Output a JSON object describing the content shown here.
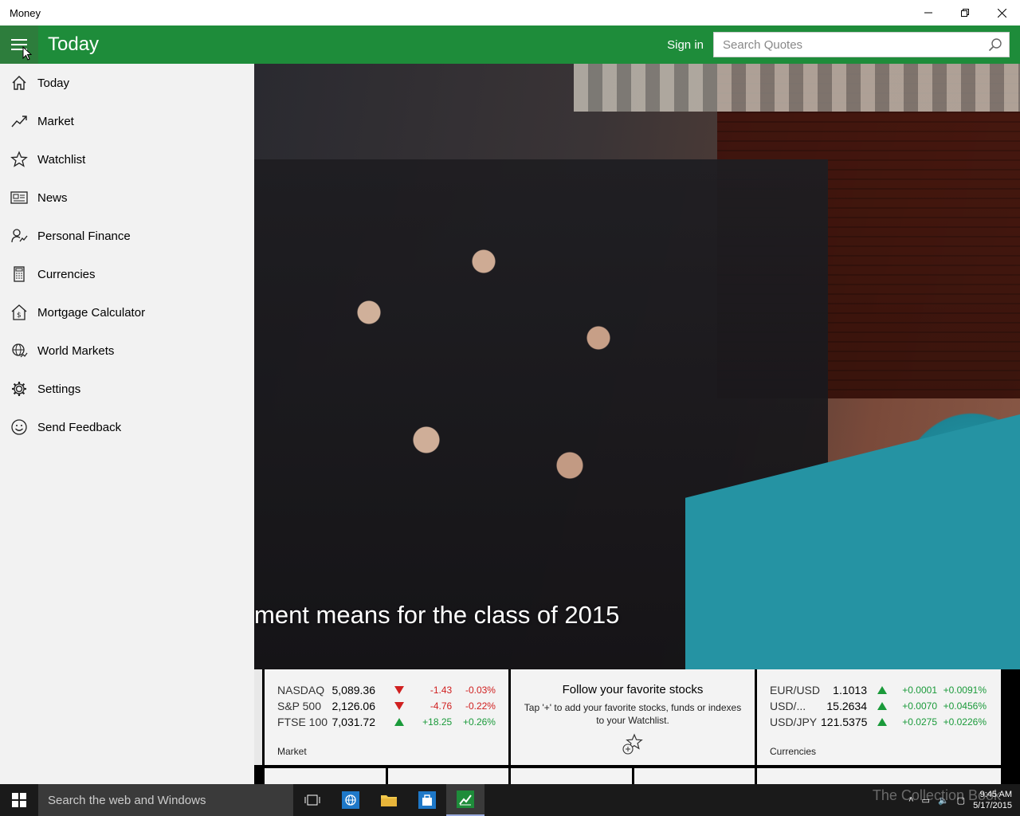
{
  "window": {
    "title": "Money",
    "minimize": "—",
    "maximize": "❐",
    "close": "✕"
  },
  "header": {
    "page_title": "Today",
    "sign_in": "Sign in",
    "search_placeholder": "Search Quotes",
    "accent": "#1e8c3a"
  },
  "sidebar": {
    "items": [
      {
        "label": "Today",
        "icon": "home-icon"
      },
      {
        "label": "Market",
        "icon": "trend-icon"
      },
      {
        "label": "Watchlist",
        "icon": "star-icon"
      },
      {
        "label": "News",
        "icon": "news-icon"
      },
      {
        "label": "Personal Finance",
        "icon": "personal-finance-icon"
      },
      {
        "label": "Currencies",
        "icon": "calculator-icon"
      },
      {
        "label": "Mortgage Calculator",
        "icon": "house-dollar-icon"
      },
      {
        "label": "World Markets",
        "icon": "globe-icon"
      },
      {
        "label": "Settings",
        "icon": "gear-icon"
      },
      {
        "label": "Send Feedback",
        "icon": "smiley-icon"
      }
    ]
  },
  "hero": {
    "headline": "ment means for the class of 2015"
  },
  "market_tile": {
    "label": "Market",
    "rows": [
      {
        "name": "NASDAQ",
        "value": "5,089.36",
        "dir": "down",
        "change": "-1.43",
        "pct": "-0.03%"
      },
      {
        "name": "S&P 500",
        "value": "2,126.06",
        "dir": "down",
        "change": "-4.76",
        "pct": "-0.22%"
      },
      {
        "name": "FTSE 100",
        "value": "7,031.72",
        "dir": "up",
        "change": "+18.25",
        "pct": "+0.26%"
      }
    ]
  },
  "watchlist_tile": {
    "title": "Follow your favorite stocks",
    "desc": "Tap '+' to add your favorite stocks, funds or indexes to your Watchlist."
  },
  "currencies_tile": {
    "label": "Currencies",
    "rows": [
      {
        "name": "EUR/USD",
        "value": "1.1013",
        "dir": "up",
        "change": "+0.0001",
        "pct": "+0.0091%"
      },
      {
        "name": "USD/...",
        "value": "15.2634",
        "dir": "up",
        "change": "+0.0070",
        "pct": "+0.0456%"
      },
      {
        "name": "USD/JPY",
        "value": "121.5375",
        "dir": "up",
        "change": "+0.0275",
        "pct": "+0.0226%"
      }
    ]
  },
  "taskbar": {
    "search_text": "Search the web and Windows",
    "time": "9:45 AM",
    "date": "5/17/2015",
    "watermark": "The Collection Book"
  }
}
